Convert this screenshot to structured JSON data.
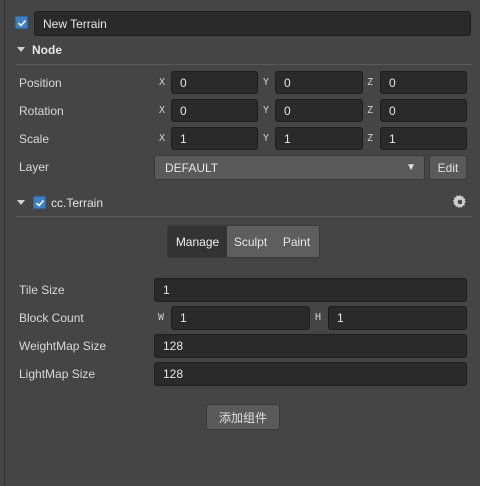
{
  "node_name": "New Terrain",
  "node_section": {
    "title": "Node",
    "rows": {
      "position": {
        "label": "Position",
        "x": "0",
        "y": "0",
        "z": "0"
      },
      "rotation": {
        "label": "Rotation",
        "x": "0",
        "y": "0",
        "z": "0"
      },
      "scale": {
        "label": "Scale",
        "x": "1",
        "y": "1",
        "z": "1"
      }
    },
    "axis_labels": {
      "x": "X",
      "y": "Y",
      "z": "Z"
    },
    "layer": {
      "label": "Layer",
      "value": "DEFAULT",
      "edit_label": "Edit"
    }
  },
  "component": {
    "title": "cc.Terrain",
    "tabs": {
      "manage": "Manage",
      "sculpt": "Sculpt",
      "paint": "Paint"
    },
    "active_tab": "Manage",
    "tile_size": {
      "label": "Tile Size",
      "value": "1"
    },
    "block_count": {
      "label": "Block Count",
      "w_label": "W",
      "h_label": "H",
      "w": "1",
      "h": "1"
    },
    "weightmap_size": {
      "label": "WeightMap Size",
      "value": "128"
    },
    "lightmap_size": {
      "label": "LightMap Size",
      "value": "128"
    }
  },
  "add_component_label": "添加组件",
  "colors": {
    "accent": "#3b82c4",
    "background": "#454545",
    "input": "#2a2a2a"
  }
}
